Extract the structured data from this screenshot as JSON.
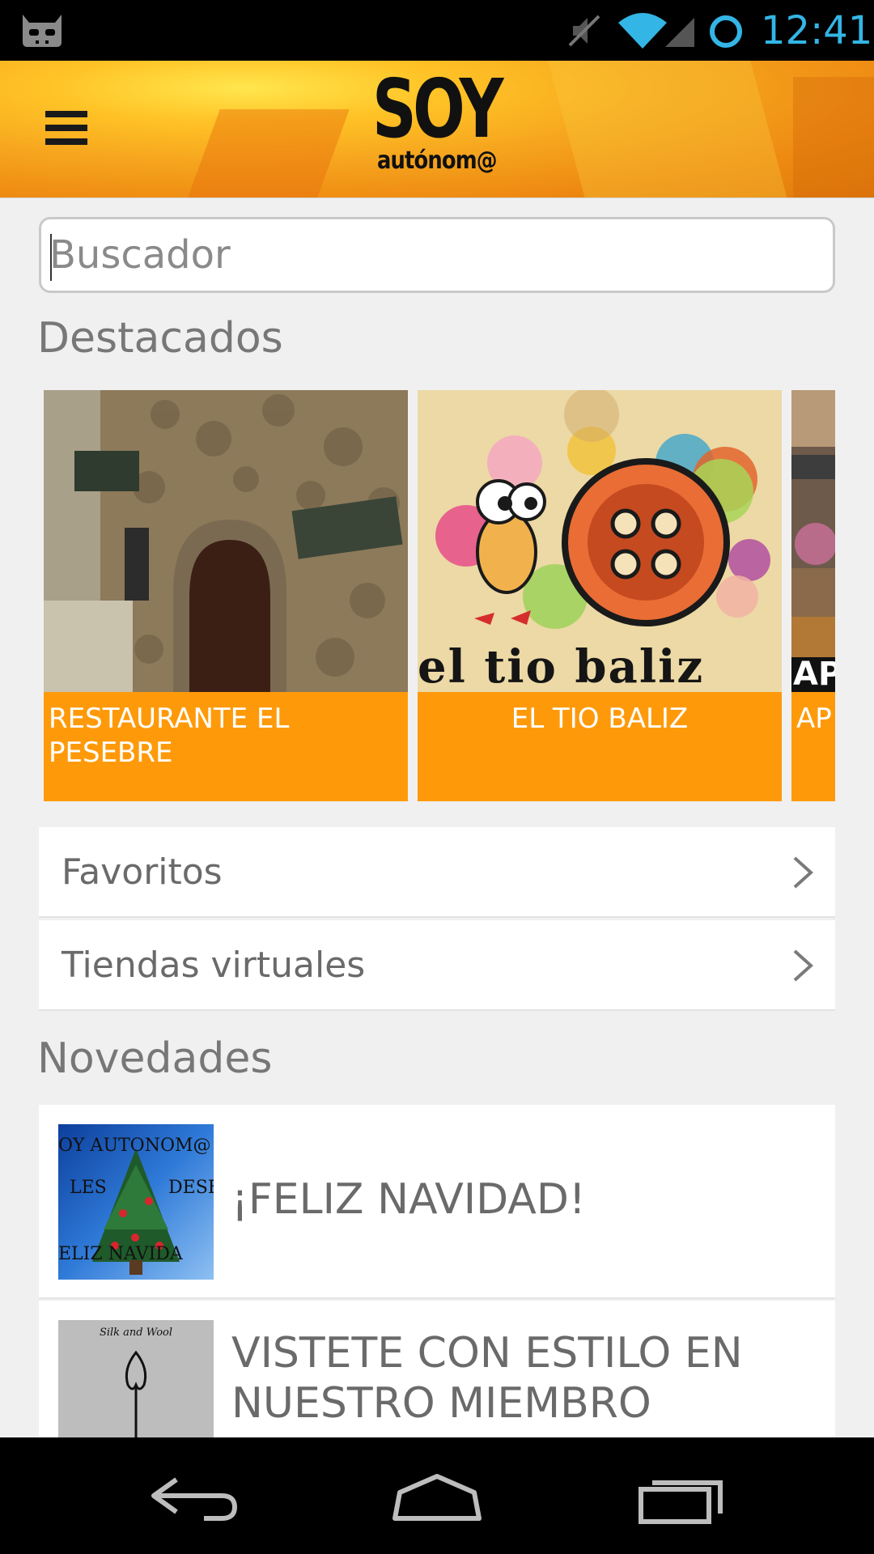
{
  "status_bar": {
    "time": "12:41",
    "icons": [
      "cyanogenmod-icon",
      "mute-icon",
      "wifi-icon",
      "signal-icon",
      "sync-icon"
    ],
    "accent_color": "#33b5e5"
  },
  "header": {
    "logo_top": "SOY",
    "logo_bottom": "autónom@",
    "menu_icon": "hamburger-menu-icon",
    "bg_color": "#f6a51e"
  },
  "search": {
    "placeholder": "Buscador",
    "value": ""
  },
  "featured": {
    "title": "Destacados",
    "accent_color": "#fe9a0a",
    "items": [
      {
        "label": "RESTAURANTE EL PESEBRE"
      },
      {
        "label": "EL TIO BALIZ",
        "image_text": "el tio baliz"
      },
      {
        "label": "AP MA",
        "image_text": "APA"
      }
    ]
  },
  "menu_rows": [
    {
      "label": "Favoritos",
      "icon": "chevron-right-icon"
    },
    {
      "label": "Tiendas virtuales",
      "icon": "chevron-right-icon"
    }
  ],
  "news": {
    "title": "Novedades",
    "items": [
      {
        "label": "¡FELIZ NAVIDAD!",
        "thumb_lines": [
          "OY AUTONOM@",
          "LES",
          "DESE",
          "ELIZ NAVIDA"
        ]
      },
      {
        "label": "VISTETE CON ESTILO EN NUESTRO MIEMBRO",
        "thumb_lines": [
          "Silk and Wool"
        ]
      }
    ]
  },
  "navbar": {
    "icons": [
      "back-icon",
      "home-icon",
      "recent-apps-icon"
    ]
  }
}
